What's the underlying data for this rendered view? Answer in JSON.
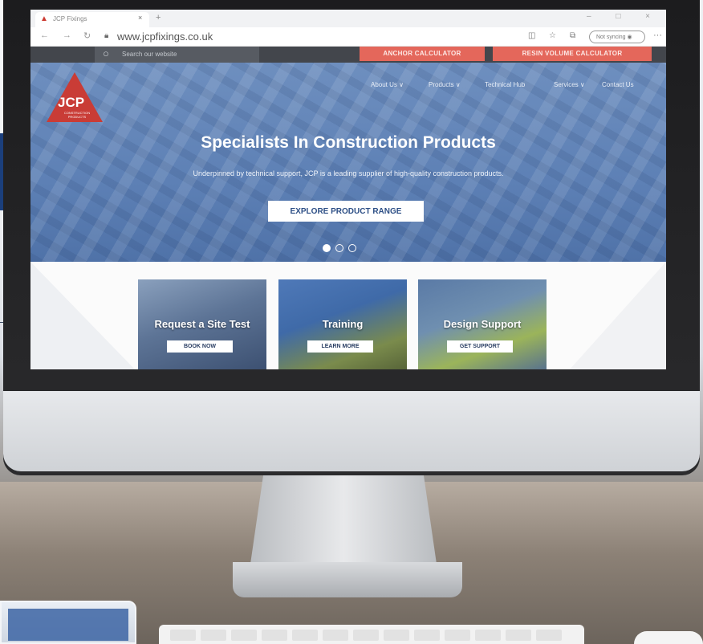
{
  "browser": {
    "tab_title": "JCP Fixings",
    "tab_close": "×",
    "new_tab": "+",
    "window_controls": "– □ ×",
    "url": "www.jcpfixings.co.uk",
    "sync_label": "Not syncing",
    "icons": [
      "back-icon",
      "forward-icon",
      "refresh-icon",
      "lock-icon",
      "reading-view-icon",
      "favorite-icon",
      "collections-icon",
      "more-icon"
    ]
  },
  "topbar": {
    "search_placeholder": "Search our website",
    "anchor_calculator": "ANCHOR CALCULATOR",
    "resin_calculator": "RESIN VOLUME CALCULATOR"
  },
  "brand": {
    "logo_text": "JCP",
    "logo_sub": "CONSTRUCTION PRODUCTS",
    "logo_color": "#c93c36"
  },
  "nav": {
    "items": [
      {
        "label": "About Us ∨"
      },
      {
        "label": "Products ∨"
      },
      {
        "label": "Technical Hub"
      },
      {
        "label": "Services ∨"
      },
      {
        "label": "Contact Us"
      }
    ]
  },
  "hero": {
    "title": "Specialists In Construction Products",
    "subtitle": "Underpinned by technical support, JCP is a leading supplier of high-quality construction products.",
    "button": "EXPLORE PRODUCT RANGE",
    "slides_total": 3,
    "active_slide": 1
  },
  "cards": [
    {
      "title": "Request a Site Test",
      "button": "BOOK NOW"
    },
    {
      "title": "Training",
      "button": "LEARN MORE"
    },
    {
      "title": "Design Support",
      "button": "GET SUPPORT"
    }
  ],
  "colors": {
    "cta_red": "#e4675b",
    "hero_blue": "#5d80b5",
    "topbar_dark": "#43464c"
  }
}
